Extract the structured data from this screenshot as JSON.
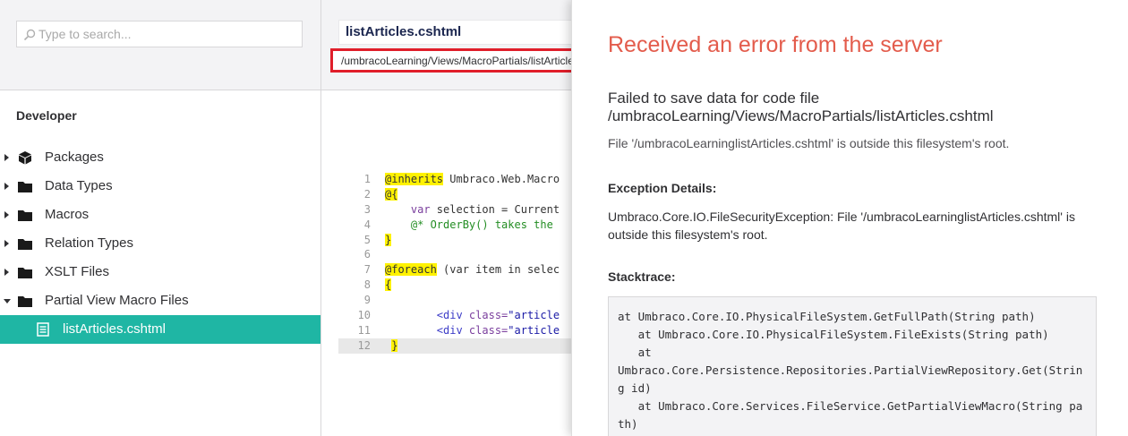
{
  "search": {
    "placeholder": "Type to search..."
  },
  "tree": {
    "section_title": "Developer",
    "items": [
      {
        "label": "Packages",
        "icon": "package-icon"
      },
      {
        "label": "Data Types",
        "icon": "folder-icon"
      },
      {
        "label": "Macros",
        "icon": "folder-icon"
      },
      {
        "label": "Relation Types",
        "icon": "folder-icon"
      },
      {
        "label": "XSLT Files",
        "icon": "folder-icon"
      },
      {
        "label": "Partial View Macro Files",
        "icon": "folder-icon"
      }
    ],
    "selected_child": {
      "label": "listArticles.cshtml",
      "icon": "document-icon"
    }
  },
  "editor": {
    "file_name": "listArticles.cshtml",
    "path": "/umbracoLearning/Views/MacroPartials/listArticles.cshtml",
    "line_numbers": [
      "1",
      "2",
      "3",
      "4",
      "5",
      "6",
      "7",
      "8",
      "9",
      "10",
      "11",
      "12"
    ],
    "lines": {
      "l1_kw": "@inherits",
      "l1_rest": " Umbraco.Web.Macro",
      "l2_kw": "@{",
      "l3_a": "    var",
      "l3_b": " selection = Current",
      "l4_comment": "    @* OrderBy() takes the",
      "l5_kw": "}",
      "l7_kw": "@foreach",
      "l7_rest": " (var item in selec",
      "l8_kw": "{",
      "l10_a": "        <div",
      "l10_b": " class=",
      "l10_c": "\"article",
      "l11_a": "        <div",
      "l11_b": " class=",
      "l11_c": "\"article",
      "l12_kw": "}"
    }
  },
  "error": {
    "title": "Received an error from the server",
    "message": "Failed to save data for code file /umbracoLearning/Views/MacroPartials/listArticles.cshtml",
    "detail": "File '/umbracoLearninglistArticles.cshtml' is outside this filesystem's root.",
    "exception_title": "Exception Details:",
    "exception_body": "Umbraco.Core.IO.FileSecurityException: File '/umbracoLearninglistArticles.cshtml' is outside this filesystem's root.",
    "stack_title": "Stacktrace:",
    "stacktrace": "at Umbraco.Core.IO.PhysicalFileSystem.GetFullPath(String path)\n   at Umbraco.Core.IO.PhysicalFileSystem.FileExists(String path)\n   at\nUmbraco.Core.Persistence.Repositories.PartialViewRepository.Get(String id)\n   at Umbraco.Core.Services.FileService.GetPartialViewMacro(String path)"
  },
  "colors": {
    "accent": "#1fb6a4",
    "error_title": "#e35c4c",
    "highlight_border": "#e01e2a"
  }
}
